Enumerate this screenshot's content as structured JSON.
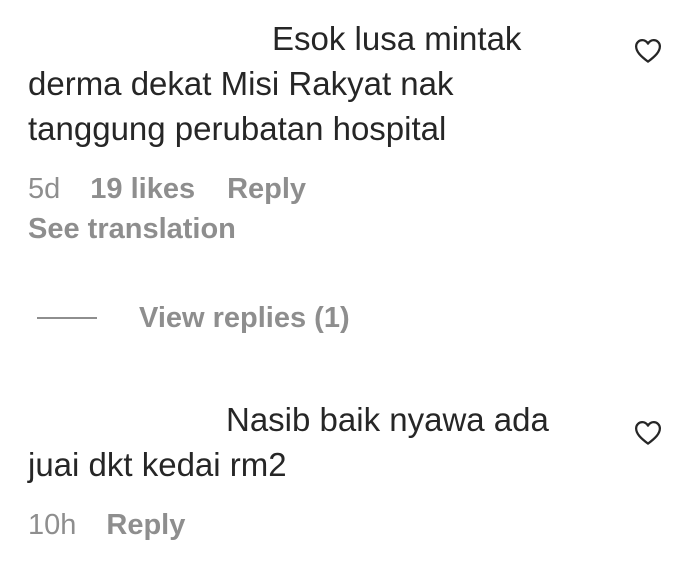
{
  "comments": [
    {
      "line1": "Esok lusa mintak",
      "line2": "derma dekat Misi Rakyat nak",
      "line3": "tanggung perubatan hospital",
      "time": "5d",
      "likes": "19 likes",
      "reply": "Reply",
      "translation": "See translation",
      "view_replies": "View replies (1)"
    },
    {
      "line1": "Nasib baik nyawa ada",
      "line2": "juai dkt kedai rm2",
      "time": "10h",
      "reply": "Reply"
    }
  ],
  "icons": {
    "like": "heart-outline-icon"
  },
  "colors": {
    "text": "#262626",
    "secondary": "#8e8e8e"
  }
}
